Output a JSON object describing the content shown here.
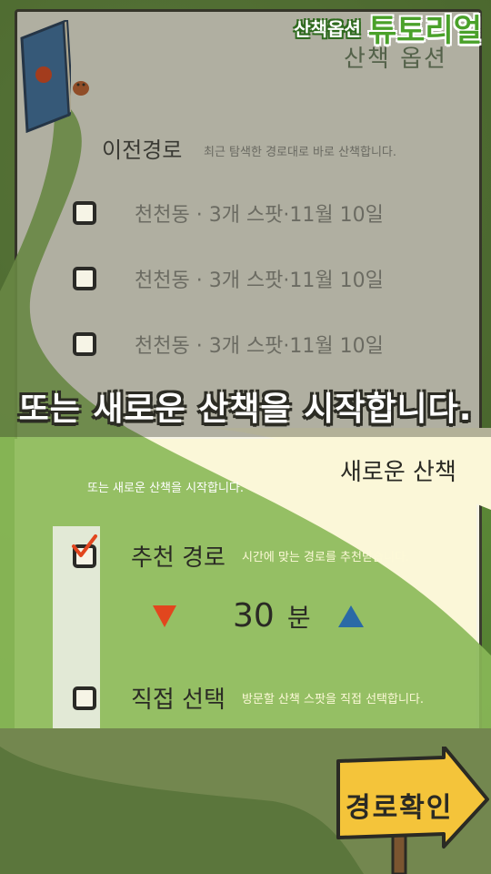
{
  "tutorial": {
    "small_label": "산책옵션",
    "big_label": "튜토리얼"
  },
  "screen_title": "산책 옵션",
  "previous": {
    "title": "이전경로",
    "description": "최근 탐색한 경로대로 바로 산책합니다.",
    "routes": [
      {
        "label": "천천동 · 3개 스팟·11월 10일"
      },
      {
        "label": "천천동 · 3개 스팟·11월 10일"
      },
      {
        "label": "천천동 · 3개 스팟·11월 10일"
      }
    ]
  },
  "banner": "또는 새로운 산책을 시작합니다.",
  "new_walk": {
    "title": "새로운 산책",
    "description": "또는 새로운 산책을 시작합니다.",
    "recommended": {
      "label": "추천 경로",
      "description": "시간에 맞는 경로를 추천받습니다.",
      "checked": true
    },
    "minutes": {
      "value": "30",
      "unit": "분"
    },
    "manual": {
      "label": "직접 선택",
      "description": "방문할 산책 스팟을 직접 선택합니다.",
      "checked": false
    }
  },
  "confirm_button": "경로확인",
  "colors": {
    "grass": "#5c8a3a",
    "paper": "#f6f4e6",
    "accent_green": "#4aa12a",
    "down_arrow": "#e2461e",
    "up_arrow": "#2a6aa6",
    "check": "#e2461e"
  }
}
